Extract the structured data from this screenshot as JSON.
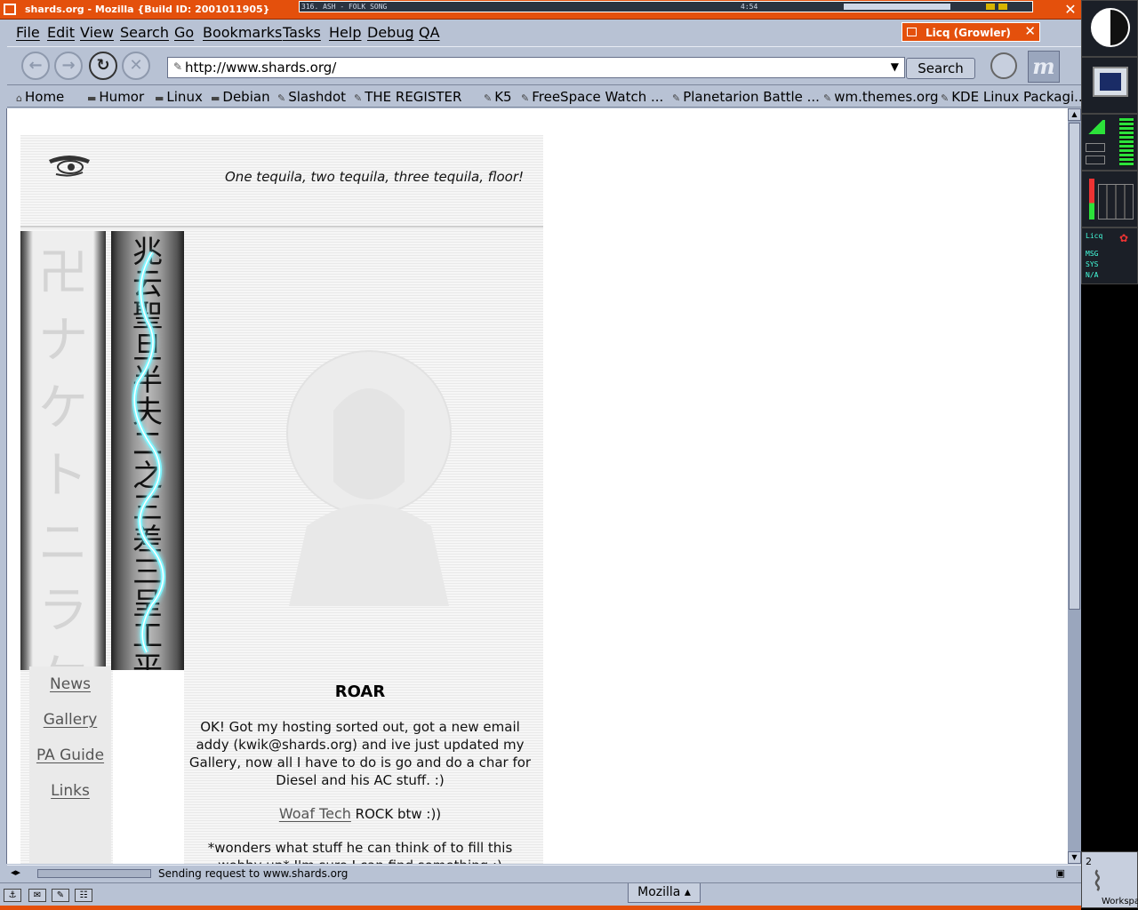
{
  "window": {
    "title": "shards.org - Mozilla {Build ID: 2001011905}",
    "dock_track": "316. ASH - FOLK SONG",
    "dock_time": "4:54"
  },
  "menu": [
    "File",
    "Edit",
    "View",
    "Search",
    "Go",
    "Bookmarks",
    "Tasks",
    "Help",
    "Debug",
    "QA"
  ],
  "licq": {
    "label": "Licq (Growler)"
  },
  "nav": {
    "url": "http://www.shards.org/",
    "search_label": "Search",
    "logo": "m"
  },
  "bookmarks": [
    {
      "label": "Home",
      "icon": "home-icon"
    },
    {
      "label": "Humor",
      "icon": "folder-icon"
    },
    {
      "label": "Linux",
      "icon": "folder-icon"
    },
    {
      "label": "Debian",
      "icon": "folder-icon"
    },
    {
      "label": "Slashdot",
      "icon": "bookmark-icon"
    },
    {
      "label": "THE REGISTER",
      "icon": "bookmark-icon"
    },
    {
      "label": "K5",
      "icon": "bookmark-icon"
    },
    {
      "label": "FreeSpace Watch ...",
      "icon": "bookmark-icon"
    },
    {
      "label": "Planetarion Battle ...",
      "icon": "bookmark-icon"
    },
    {
      "label": "wm.themes.org",
      "icon": "bookmark-icon"
    },
    {
      "label": "KDE Linux Packagi...",
      "icon": "bookmark-icon"
    }
  ],
  "page": {
    "tagline": "One tequila, two tequila, three tequila, floor!",
    "nav_links": [
      "News",
      "Gallery",
      "PA Guide",
      "Links"
    ],
    "heading": "ROAR",
    "para1": "OK! Got my hosting sorted out, got a new email addy (kwik@shards.org) and ive just updated my Gallery, now all I have to do is go and do a char for Diesel and his AC stuff. :)",
    "para2_link": "Woaf Tech",
    "para2_rest": " ROCK btw :))",
    "para3": "*wonders what stuff he can think of to fill this webby up* I'm sure I can find something :)"
  },
  "status": {
    "text": "Sending request to www.shards.org"
  },
  "taskbar": {
    "task_label": "Mozilla"
  },
  "dock": {
    "workspace_num": "2",
    "workspace_label": "Workspa",
    "licq_label": "Licq",
    "rows": [
      "MSG",
      "SYS",
      "N/A"
    ]
  },
  "colors": {
    "titlebar": "#e4500c",
    "chrome": "#b8c2d4",
    "lightning": "#7ff6ff"
  }
}
